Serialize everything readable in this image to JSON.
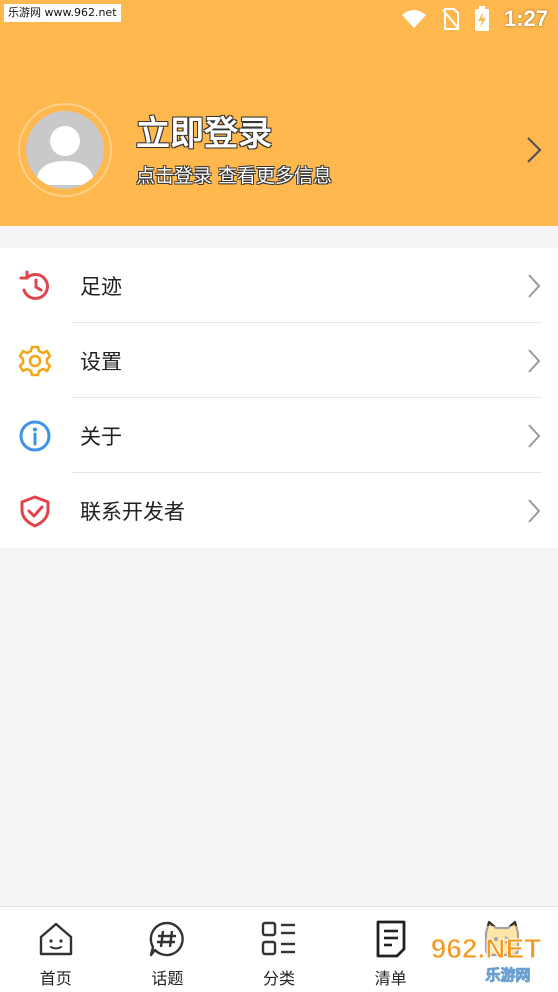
{
  "status_bar": {
    "watermark": "乐游网 www.962.net",
    "time": "1:27"
  },
  "profile": {
    "title": "立即登录",
    "subtitle": "点击登录 查看更多信息"
  },
  "menu": {
    "items": [
      {
        "label": "足迹",
        "icon": "history-icon"
      },
      {
        "label": "设置",
        "icon": "gear-icon"
      },
      {
        "label": "关于",
        "icon": "info-icon"
      },
      {
        "label": "联系开发者",
        "icon": "shield-check-icon"
      }
    ]
  },
  "bottom_nav": {
    "items": [
      {
        "label": "首页",
        "icon": "home-icon"
      },
      {
        "label": "话题",
        "icon": "hashtag-chat-icon"
      },
      {
        "label": "分类",
        "icon": "category-list-icon"
      },
      {
        "label": "清单",
        "icon": "document-list-icon"
      },
      {
        "label": "",
        "icon": "cat-mascot-icon"
      }
    ]
  },
  "watermark": {
    "brand": "962.NET",
    "name": "乐游网"
  },
  "colors": {
    "header_bg": "#ffb84d",
    "history_icon": "#e0454d",
    "gear_icon": "#f2a818",
    "info_icon": "#3d93e6",
    "shield_icon": "#e0454d"
  }
}
